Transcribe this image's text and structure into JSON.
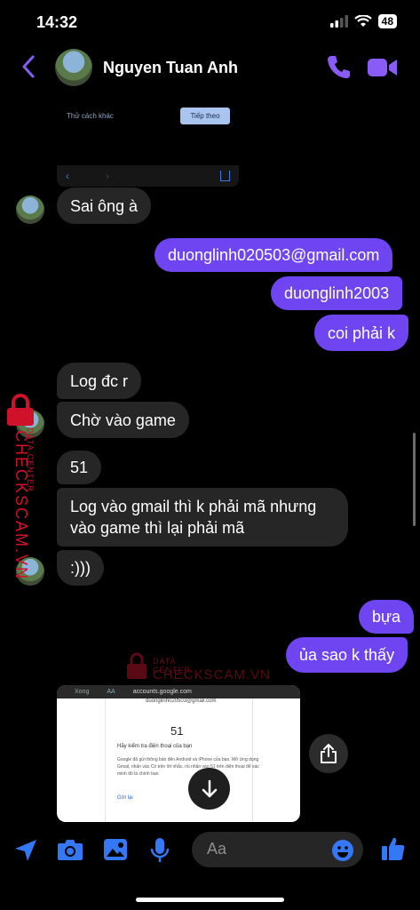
{
  "status": {
    "time": "14:32",
    "battery": "48"
  },
  "header": {
    "name": "Nguyen Tuan Anh"
  },
  "shot_top": {
    "other": "Thử cách khác",
    "next": "Tiếp theo"
  },
  "messages": {
    "m1": "Sai ông à",
    "m2": "duonglinh020503@gmail.com",
    "m3": "duonglinh2003",
    "m4": "coi phải k",
    "m5": "Log đc r",
    "m6": "Chờ vào game",
    "m7": "51",
    "m8": "Log vào gmail thì k phải mã nhưng vào game thì lại phải mã",
    "m9": ":)))",
    "m10": "bựa",
    "m11": "ủa sao k thấy"
  },
  "shot_bottom": {
    "back": "Xong",
    "font_size": "AA",
    "url": "accounts.google.com",
    "email": "duonglinh020503@gmail.com",
    "code": "51",
    "heading": "Hãy kiểm tra điện thoại của bạn",
    "body": "Google đã gửi thông báo đến Android và iPhone của bạn. Mở ứng dụng Gmail, nhấn vào Có trên lời nhắc, rồi nhấn vào 51 trên điện thoại để xác minh đó là chính bạn.",
    "resend": "Gửi lại"
  },
  "composer": {
    "placeholder": "Aa"
  },
  "watermark": {
    "main": "CHECKSCAM.VN",
    "sub": "DATA CENTER"
  },
  "colors": {
    "accent": "#6e45f0",
    "incoming": "#262626",
    "icon": "#3478f6",
    "watermark": "#d0112a"
  }
}
